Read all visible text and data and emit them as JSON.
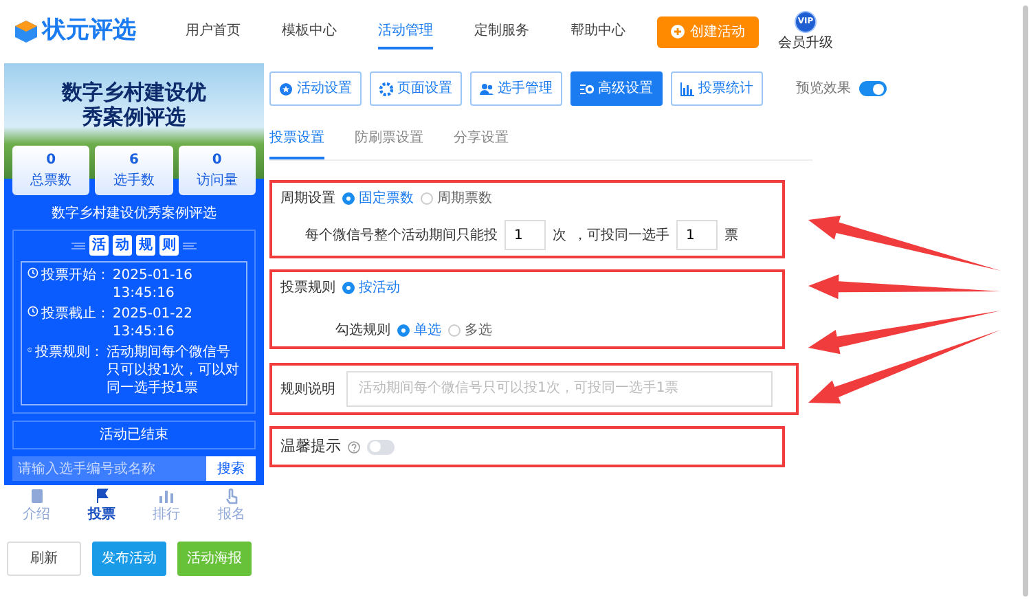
{
  "nav": {
    "logo": "状元评选",
    "items": [
      {
        "label": "用户首页",
        "selected": false
      },
      {
        "label": "模板中心",
        "selected": false
      },
      {
        "label": "活动管理",
        "selected": true
      },
      {
        "label": "定制服务",
        "selected": false
      },
      {
        "label": "帮助中心",
        "selected": false
      }
    ],
    "create_button": "创建活动",
    "vip_badge": "VIP",
    "vip_label": "会员升级"
  },
  "preview": {
    "banner_title": "数字乡村建设优秀案例评选",
    "stats": [
      {
        "value": "0",
        "label": "总票数"
      },
      {
        "value": "6",
        "label": "选手数"
      },
      {
        "value": "0",
        "label": "访问量"
      }
    ],
    "activity_title": "数字乡村建设优秀案例评选",
    "rules_title": "活动规则",
    "rules": [
      {
        "label": "投票开始：",
        "value": "2025-01-16 13:45:16"
      },
      {
        "label": "投票截止：",
        "value": "2025-01-22 13:45:16"
      },
      {
        "label": "投票规则：",
        "value": "活动期间每个微信号只可以投1次，可以对同一选手投1票"
      }
    ],
    "status": "活动已结束",
    "search": {
      "placeholder": "请输入选手编号或名称",
      "button": "搜索"
    },
    "tabs": [
      {
        "label": "介绍",
        "selected": false
      },
      {
        "label": "投票",
        "selected": true
      },
      {
        "label": "排行",
        "selected": false
      },
      {
        "label": "报名",
        "selected": false
      }
    ]
  },
  "actions": [
    {
      "label": "刷新",
      "kind": "default"
    },
    {
      "label": "发布活动",
      "kind": "primary"
    },
    {
      "label": "活动海报",
      "kind": "success"
    }
  ],
  "settings_tabs": [
    {
      "label": "活动设置",
      "selected": false
    },
    {
      "label": "页面设置",
      "selected": false
    },
    {
      "label": "选手管理",
      "selected": false
    },
    {
      "label": "高级设置",
      "selected": true
    },
    {
      "label": "投票统计",
      "selected": false
    }
  ],
  "preview_toggle": {
    "label": "预览效果",
    "on": true
  },
  "sub_tabs": [
    {
      "label": "投票设置",
      "selected": true
    },
    {
      "label": "防刷票设置",
      "selected": false
    },
    {
      "label": "分享设置",
      "selected": false
    }
  ],
  "period": {
    "label": "周期设置",
    "options": [
      {
        "label": "固定票数",
        "selected": true
      },
      {
        "label": "周期票数",
        "selected": false
      }
    ],
    "prefix": "每个微信号整个活动期间只能投",
    "votes_value": "1",
    "unit": "次",
    "middle": "，可投同一选手",
    "per_player_value": "1",
    "suffix": "票"
  },
  "vote_rule": {
    "label": "投票规则",
    "options": [
      {
        "label": "按活动",
        "selected": true
      }
    ],
    "check_label": "勾选规则",
    "check_options": [
      {
        "label": "单选",
        "selected": true
      },
      {
        "label": "多选",
        "selected": false
      }
    ]
  },
  "description": {
    "label": "规则说明",
    "placeholder": "活动期间每个微信号只可以投1次，可投同一选手1票"
  },
  "reminder": {
    "label": "温馨提示",
    "on": false
  }
}
